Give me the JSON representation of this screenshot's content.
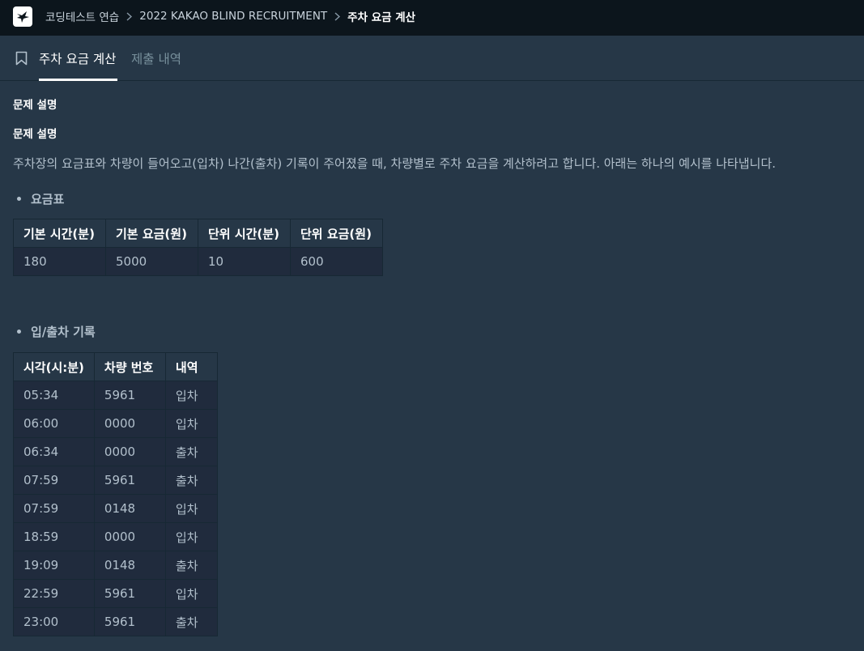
{
  "breadcrumb": {
    "items": [
      "코딩테스트 연습",
      "2022 KAKAO BLIND RECRUITMENT"
    ],
    "current": "주차 요금 계산"
  },
  "tabs": {
    "active": "주차 요금 계산",
    "inactive": "제출 내역"
  },
  "problem": {
    "heading1": "문제 설명",
    "heading2": "문제 설명",
    "intro": "주차장의 요금표와 차량이 들어오고(입차) 나간(출차) 기록이 주어졌을 때, 차량별로 주차 요금을 계산하려고 합니다. 아래는 하나의 예시를 나타냅니다.",
    "fee_table": {
      "title": "요금표",
      "headers": [
        "기본 시간(분)",
        "기본 요금(원)",
        "단위 시간(분)",
        "단위 요금(원)"
      ],
      "rows": [
        [
          "180",
          "5000",
          "10",
          "600"
        ]
      ]
    },
    "log_table": {
      "title": "입/출차 기록",
      "headers": [
        "시각(시:분)",
        "차량 번호",
        "내역"
      ],
      "rows": [
        [
          "05:34",
          "5961",
          "입차"
        ],
        [
          "06:00",
          "0000",
          "입차"
        ],
        [
          "06:34",
          "0000",
          "출차"
        ],
        [
          "07:59",
          "5961",
          "출차"
        ],
        [
          "07:59",
          "0148",
          "입차"
        ],
        [
          "18:59",
          "0000",
          "입차"
        ],
        [
          "19:09",
          "0148",
          "출차"
        ],
        [
          "22:59",
          "5961",
          "입차"
        ],
        [
          "23:00",
          "5961",
          "출차"
        ]
      ]
    }
  },
  "icons": {
    "logo": "programmers-logo-icon",
    "separator": "chevron-right-icon",
    "bookmark": "bookmark-icon"
  }
}
